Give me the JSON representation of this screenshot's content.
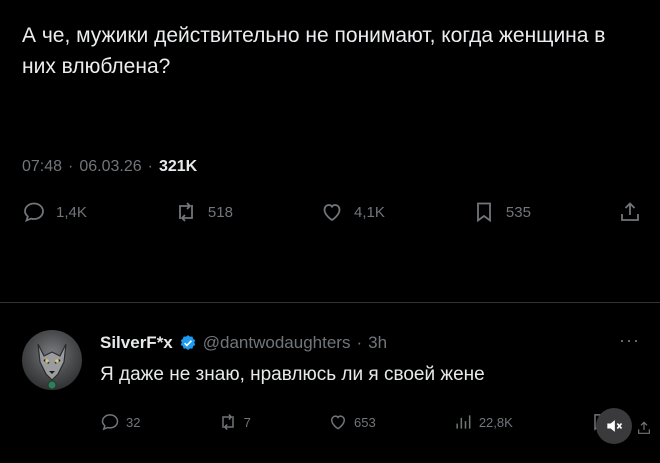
{
  "tweet": {
    "text": "А че, мужики действительно не понимают, когда женщина в них влюблена?",
    "time": "07:48",
    "date": "06.03.26",
    "sep": "·",
    "views": "321K"
  },
  "actions": {
    "replies": "1,4K",
    "reposts": "518",
    "likes": "4,1K",
    "bookmarks": "535"
  },
  "reply": {
    "name": "SilverF*x",
    "handle": "@dantwodaughters",
    "time_ago": "3h",
    "sep": "·",
    "more": "···",
    "text": "Я даже не знаю, нравлюсь ли я своей жене",
    "replies": "32",
    "reposts": "7",
    "likes": "653",
    "views": "22,8K"
  },
  "icons": {
    "reply": "reply-icon",
    "repost": "repost-icon",
    "like": "heart-icon",
    "bookmark": "bookmark-icon",
    "share": "share-icon",
    "views": "views-icon",
    "verified": "verified-badge-icon",
    "mute": "mute-icon"
  },
  "colors": {
    "background": "#000000",
    "text": "#e7e9ea",
    "muted": "#71767b",
    "verified": "#1d9bf0",
    "divider": "#2f3336"
  }
}
